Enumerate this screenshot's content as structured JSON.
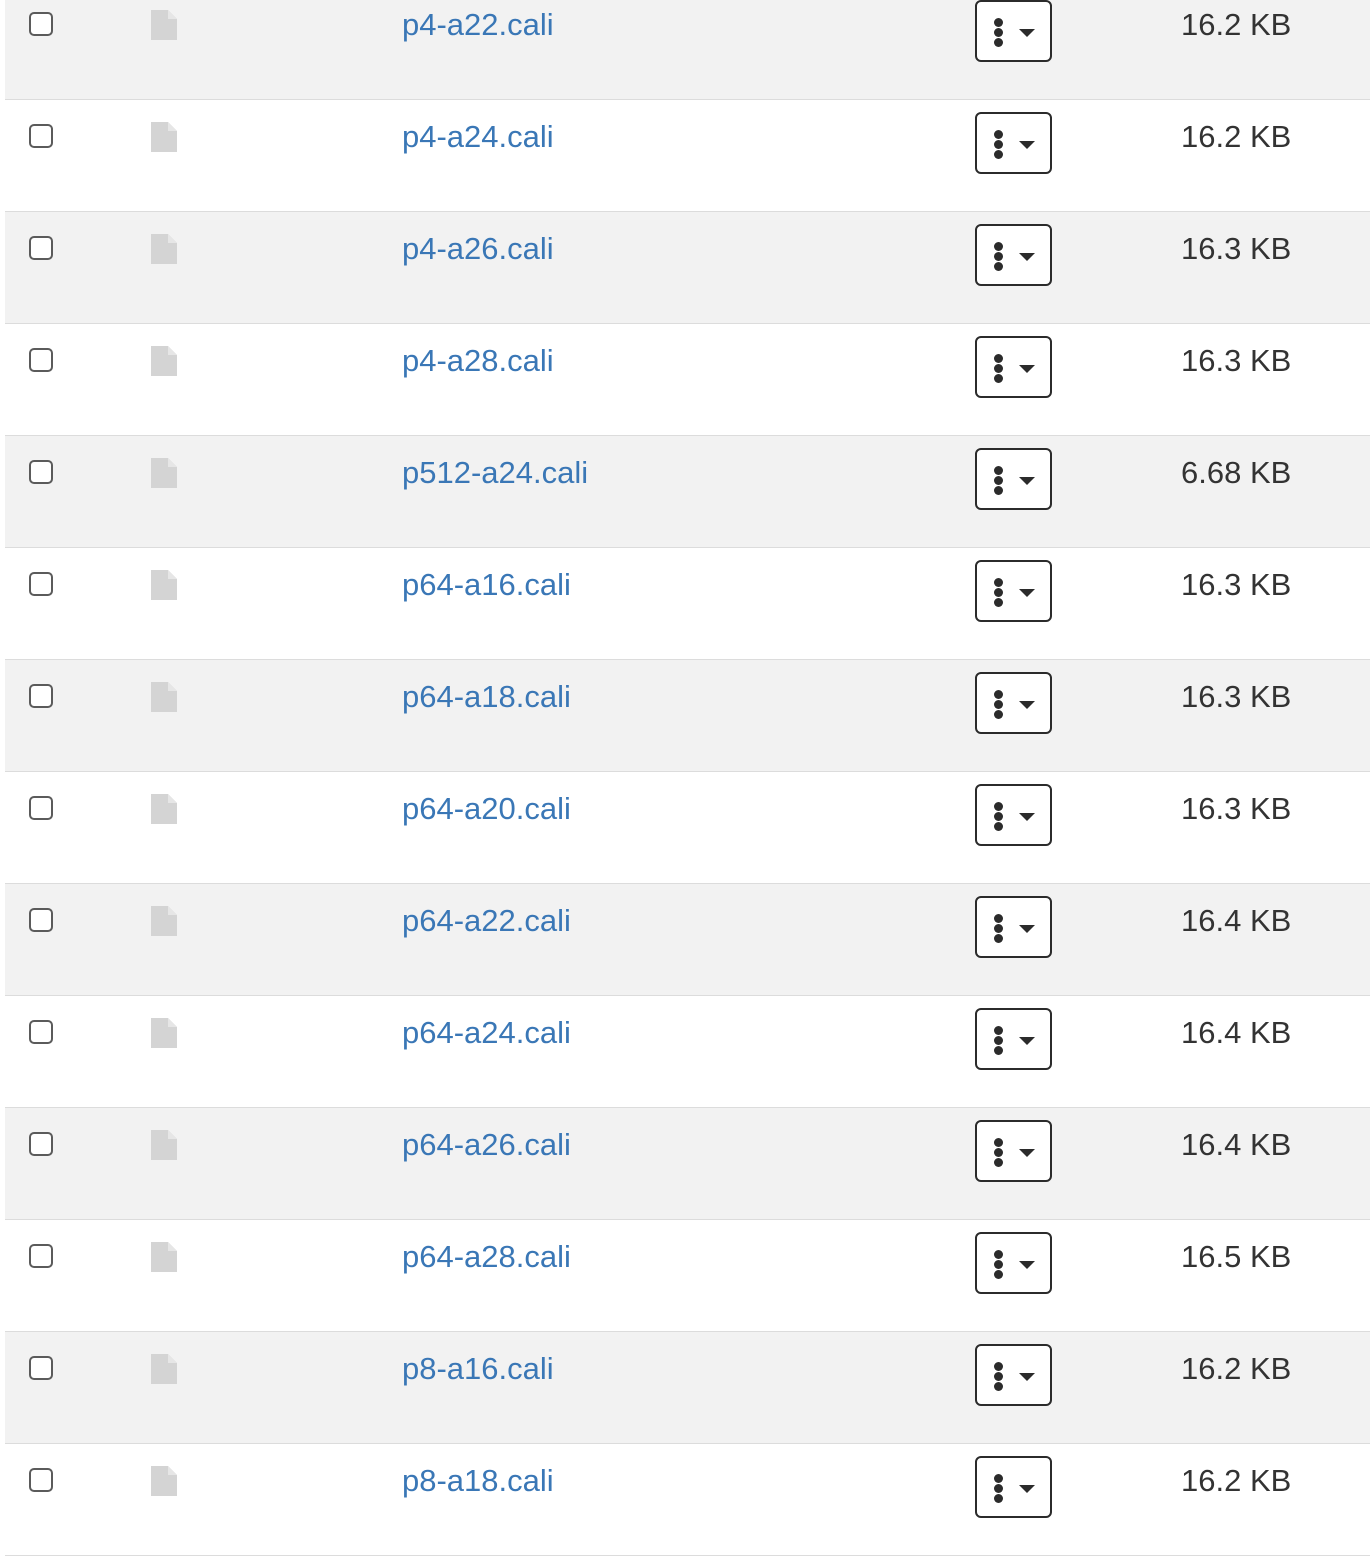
{
  "file_list": {
    "rows": [
      {
        "name": "p4-a22.cali",
        "size": "16.2 KB",
        "checked": false
      },
      {
        "name": "p4-a24.cali",
        "size": "16.2 KB",
        "checked": false
      },
      {
        "name": "p4-a26.cali",
        "size": "16.3 KB",
        "checked": false
      },
      {
        "name": "p4-a28.cali",
        "size": "16.3 KB",
        "checked": false
      },
      {
        "name": "p512-a24.cali",
        "size": "6.68 KB",
        "checked": false
      },
      {
        "name": "p64-a16.cali",
        "size": "16.3 KB",
        "checked": false
      },
      {
        "name": "p64-a18.cali",
        "size": "16.3 KB",
        "checked": false
      },
      {
        "name": "p64-a20.cali",
        "size": "16.3 KB",
        "checked": false
      },
      {
        "name": "p64-a22.cali",
        "size": "16.4 KB",
        "checked": false
      },
      {
        "name": "p64-a24.cali",
        "size": "16.4 KB",
        "checked": false
      },
      {
        "name": "p64-a26.cali",
        "size": "16.4 KB",
        "checked": false
      },
      {
        "name": "p64-a28.cali",
        "size": "16.5 KB",
        "checked": false
      },
      {
        "name": "p8-a16.cali",
        "size": "16.2 KB",
        "checked": false
      },
      {
        "name": "p8-a18.cali",
        "size": "16.2 KB",
        "checked": false
      }
    ],
    "row_icon": "file-icon",
    "action_icons": [
      "kebab-vertical-icon",
      "caret-down-icon"
    ],
    "colors": {
      "link": "#3a77b6",
      "text": "#333333",
      "row_stripe": "#f2f2f2",
      "row_border": "#dcdcdc",
      "icon_gray": "#d4d4d4"
    }
  }
}
